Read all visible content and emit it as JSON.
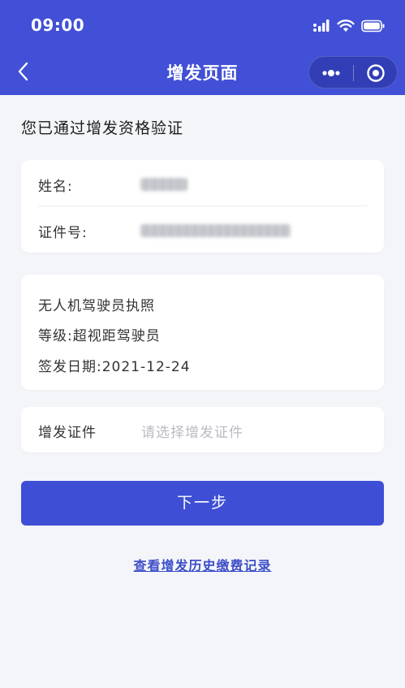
{
  "status_bar": {
    "time": "09:00"
  },
  "nav": {
    "title": "增发页面"
  },
  "section_title": "您已通过增发资格验证",
  "identity": {
    "name_label": "姓名:",
    "id_label": "证件号:"
  },
  "license": {
    "title": "无人机驾驶员执照",
    "level": "等级:超视距驾驶员",
    "issue_date": "签发日期:2021-12-24"
  },
  "select": {
    "label": "增发证件",
    "placeholder": "请选择增发证件"
  },
  "next_button": "下一步",
  "history_link": "查看增发历史缴费记录",
  "colors": {
    "brand": "#4150d6",
    "button": "#3e4fd5",
    "link": "#3d4ec9",
    "background": "#f4f5f9"
  }
}
